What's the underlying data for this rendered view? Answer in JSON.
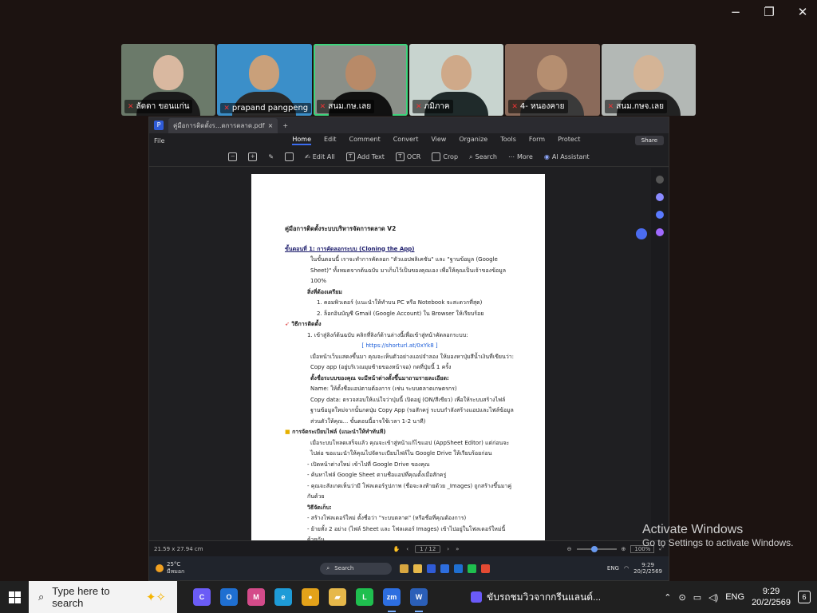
{
  "window_controls": {
    "minimize": "−",
    "restore": "❐",
    "close": "✕"
  },
  "participants": [
    {
      "name": "ลัดดา ขอนแก่น",
      "bg": "#6b7a6a",
      "skin": "#d9b8a0",
      "shirt": "#1b1b1b"
    },
    {
      "name": "prapand pangpeng",
      "bg": "#3b8fc9",
      "skin": "#c9a07a",
      "shirt": "#2a2a2a"
    },
    {
      "name": "สนม.กษ.เลย",
      "bg": "#8a8f88",
      "skin": "#b88a68",
      "shirt": "#111111"
    },
    {
      "name": "ภมิภาค",
      "bg": "#c8d4cf",
      "skin": "#cfa989",
      "shirt": "#1f2a2a"
    },
    {
      "name": "4- หนองคาย",
      "bg": "#8a6a5a",
      "skin": "#b58e70",
      "shirt": "#3a3a3a"
    },
    {
      "name": "สนม.กษจ.เลย",
      "bg": "#b3b8b5",
      "skin": "#d4b496",
      "shirt": "#222222"
    }
  ],
  "pdf": {
    "tab_title": "คู่มือการติดตั้งร...ดการตลาด.pdf",
    "new_tab": "+",
    "file_label": "File",
    "menus": [
      "Home",
      "Edit",
      "Comment",
      "Convert",
      "View",
      "Organize",
      "Tools",
      "Form",
      "Protect"
    ],
    "active_menu": "Home",
    "share": "Share",
    "tools": {
      "zoom_out": "−",
      "zoom_in": "+",
      "edit_all": "Edit All",
      "add_text": "Add Text",
      "ocr": "OCR",
      "crop": "Crop",
      "search": "Search",
      "more": "More",
      "ai": "AI Assistant"
    },
    "page_size": "21.59 x 27.94 cm",
    "page_num": "1 / 12",
    "zoom": "100%"
  },
  "document": {
    "title": "คู่มือการติดตั้งระบบบริหารจัดการตลาด V2",
    "step1_heading": "ขั้นตอนที่ 1: การคัดลอกระบบ (Cloning the App)",
    "step1_p1": "ในขั้นตอนนี้ เราจะทำการคัดลอก \"ตัวแอปพลิเคชัน\" และ \"ฐานข้อมูล (Google Sheet)\" ทั้งหมดจากต้นฉบับ มาเก็บไว้เป็นของคุณเอง เพื่อให้คุณเป็นเจ้าของข้อมูล 100%",
    "prep_heading": "สิ่งที่ต้องเตรียม",
    "prep_1": "1. คอมพิวเตอร์ (แนะนำให้ทำบน PC หรือ Notebook จะสะดวกที่สุด)",
    "prep_2": "2. ล็อกอินบัญชี Gmail (Google Account) ใน Browser ให้เรียบร้อย",
    "method_heading": "วิธีการติดตั้ง",
    "method_1": "1. เข้าสู่ลิงก์ต้นฉบับ คลิกที่ลิงก์ด้านล่างนี้เพื่อเข้าสู่หน้าคัดลอกระบบ:",
    "link": "[ https://shorturl.at/0xYk8 ]",
    "method_1b": "เมื่อหน้าเว็บแสดงขึ้นมา คุณจะเห็นตัวอย่างแอปจำลอง ให้มองหาปุ่มสีน้ำเงินที่เขียนว่า: Copy app (อยู่บริเวณมุมซ้ายของหน้าจอ) กดที่ปุ่มนี้ 1 ครั้ง",
    "name_heading": "ตั้งชื่อระบบของคุณ จะมีหน้าต่างตั้งขึ้นมาถามรายละเอียด:",
    "name_line": "Name: ให้ตั้งชื่อแอปตามต้องการ (เช่น ระบบตลาดเกษตรกร)",
    "copy_data": "Copy data: ตรวจสอบให้แน่ใจว่าปุ่มนี้ เปิดอยู่ (ON/สีเขียว) เพื่อให้ระบบสร้างไฟล์ฐานข้อมูลใหม่จากนั้นกดปุ่ม Copy App (รอสักครู่ ระบบกำลังสร้างแอปและไฟล์ข้อมูลส่วนตัวให้คุณ... ขั้นตอนนี้อาจใช้เวลา 1-2 นาที)",
    "files_heading": "การจัดระเบียบไฟล์ (แนะนำให้ทำทันที)",
    "files_p": "เมื่อระบบโหลดเสร็จแล้ว คุณจะเข้าสู่หน้าแก้ไขแอป (AppSheet Editor) แต่ก่อนจะไปต่อ ขอแนะนำให้คุณไปจัดระเบียบไฟล์ใน Google Drive ให้เรียบร้อยก่อน",
    "files_1": "- เปิดหน้าต่างใหม่ เข้าไปที่ Google Drive ของคุณ",
    "files_2": "- ค้นหาไฟล์ Google Sheet ตามชื่อแอปที่คุณตั้งเมื่อสักครู่",
    "files_3": "- คุณจะสังเกตเห็นว่ามี โฟลเดอร์รูปภาพ (ชื่อจะลงท้ายด้วย _Images) ถูกสร้างขึ้นมาคู่กันด้วย",
    "manage_heading": "วิธีจัดเก็บ:",
    "manage_1": "- สร้างโฟลเดอร์ใหม่ ตั้งชื่อว่า \"ระบบตลาด\" (หรือชื่อที่คุณต้องการ)",
    "manage_2": "- ย้ายทั้ง 2 อย่าง (ไฟล์ Sheet และ โฟลเดอร์ Images) เข้าไปอยู่ในโฟลเดอร์ใหม่นี้ด้วยกัน"
  },
  "inner_taskbar": {
    "temp": "25°C",
    "weather": "มีหมอก",
    "search": "Search",
    "lang": "ENG",
    "time": "9:29",
    "date": "20/2/2569"
  },
  "watermark": {
    "line1": "Activate Windows",
    "line2": "Go to Settings to activate Windows."
  },
  "taskbar": {
    "search_placeholder": "Type here to search",
    "notification_text": "ขับรถชมวิวจากกรีนแลนด์...",
    "lang": "ENG",
    "time": "9:29",
    "date": "20/2/2569",
    "notif_count": "6",
    "apps": [
      {
        "name": "copilot",
        "label": "C",
        "color": "#6b5cf6"
      },
      {
        "name": "outlook",
        "label": "O",
        "color": "#1f6fd1"
      },
      {
        "name": "m365",
        "label": "M",
        "color": "#d44b8a"
      },
      {
        "name": "edge",
        "label": "e",
        "color": "#1e9bd7"
      },
      {
        "name": "chrome",
        "label": "●",
        "color": "#e3a21a"
      },
      {
        "name": "file-explorer",
        "label": "▰",
        "color": "#e6b84a"
      },
      {
        "name": "line",
        "label": "L",
        "color": "#1fbf4f"
      },
      {
        "name": "zoom",
        "label": "zm",
        "color": "#2d6ee0"
      },
      {
        "name": "word",
        "label": "W",
        "color": "#2b5fb8"
      }
    ]
  }
}
